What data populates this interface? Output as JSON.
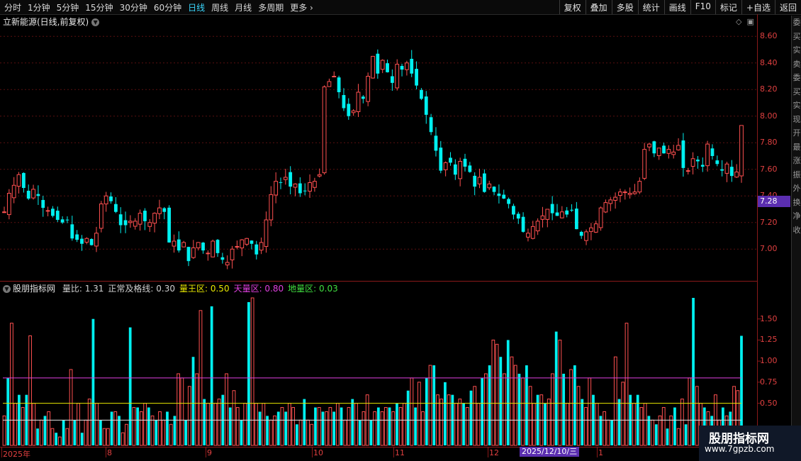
{
  "toolbar": {
    "periods": [
      "分时",
      "1分钟",
      "5分钟",
      "15分钟",
      "30分钟",
      "60分钟",
      "日线",
      "周线",
      "月线",
      "多周期",
      "更多 ›"
    ],
    "active_index": 6,
    "right_buttons": [
      "复权",
      "叠加",
      "多股",
      "统计",
      "画线",
      "F10",
      "标记",
      "+自选",
      "返回"
    ]
  },
  "stock": {
    "title": "立新能源(日线,前复权)"
  },
  "side_strip": [
    "委",
    "买",
    "实",
    "卖",
    "委",
    "买",
    "实",
    "现",
    "开",
    "最",
    "涨",
    "振",
    "外",
    "换",
    "净",
    "收"
  ],
  "price_axis": [
    "8.60",
    "8.40",
    "8.20",
    "8.00",
    "7.80",
    "7.60",
    "7.40",
    "7.20",
    "7.00"
  ],
  "current_price": "7.28",
  "indicator": {
    "name": "股朋指标网",
    "items": [
      {
        "label": "量比:",
        "value": "1.31",
        "color": "#d0d0d0"
      },
      {
        "label": "正常及格线:",
        "value": "0.30",
        "color": "#d0d0d0"
      },
      {
        "label": "量王区:",
        "value": "0.50",
        "color": "#e8e800"
      },
      {
        "label": "天量区:",
        "value": "0.80",
        "color": "#e040e0"
      },
      {
        "label": "地量区:",
        "value": "0.03",
        "color": "#40e040"
      }
    ]
  },
  "volume_axis": [
    "1.50",
    "1.25",
    "1.00",
    "0.75",
    "0.50"
  ],
  "date_axis": [
    "2025年",
    "8",
    "9",
    "10",
    "11",
    "12",
    "1"
  ],
  "date_cursor": "2025/12/10/三",
  "watermark": {
    "name": "股朋指标网",
    "url": "www.7gpzb.com"
  },
  "colors": {
    "up": "#ff5050",
    "down": "#00f0f0",
    "yellow": "#e8e800",
    "magenta": "#e040e0",
    "white": "#e0e0e0"
  },
  "chart_data": [
    {
      "type": "candlestick",
      "title": "立新能源(日线,前复权)",
      "ylim": [
        6.82,
        8.66
      ],
      "close": [
        7.28,
        7.42,
        7.48,
        7.56,
        7.46,
        7.38,
        7.45,
        7.4,
        7.31,
        7.29,
        7.25,
        7.22,
        7.2,
        7.22,
        7.08,
        7.07,
        7.04,
        7.08,
        7.03,
        7.12,
        7.34,
        7.4,
        7.36,
        7.28,
        7.18,
        7.18,
        7.21,
        7.21,
        7.27,
        7.21,
        7.2,
        7.27,
        7.31,
        7.28,
        7.05,
        7.06,
        6.99,
        7.05,
        6.91,
        7.01,
        7.05,
        6.99,
        6.97,
        7.06,
        6.97,
        6.92,
        6.9,
        7.0,
        7.02,
        7.07,
        7.08,
        7.04,
        6.96,
        7.05,
        7.22,
        7.41,
        7.51,
        7.5,
        7.54,
        7.47,
        7.49,
        7.42,
        7.44,
        7.5,
        7.51,
        7.56,
        8.22,
        8.26,
        8.3,
        8.18,
        8.06,
        8.0,
        8.04,
        8.18,
        8.13,
        8.3,
        8.45,
        8.32,
        8.42,
        8.33,
        8.25,
        8.39,
        8.35,
        8.4,
        8.32,
        8.23,
        8.13,
        8.01,
        7.88,
        7.74,
        7.59,
        7.65,
        7.65,
        7.56,
        7.66,
        7.62,
        7.58,
        7.47,
        7.54,
        7.43,
        7.49,
        7.43,
        7.4,
        7.38,
        7.34,
        7.26,
        7.23,
        7.13,
        7.12,
        7.17,
        7.21,
        7.25,
        7.3,
        7.27,
        7.25,
        7.28,
        7.26,
        7.29,
        7.15,
        7.1,
        7.13,
        7.16,
        7.19,
        7.31,
        7.35,
        7.37,
        7.39,
        7.43,
        7.43,
        7.42,
        7.43,
        7.51,
        7.75,
        7.79,
        7.72,
        7.76,
        7.72,
        7.75,
        7.73,
        7.78,
        7.61,
        7.59,
        7.68,
        7.66,
        7.62,
        7.79,
        7.7,
        7.64,
        7.59,
        7.64,
        7.55,
        7.58,
        7.93
      ]
    },
    {
      "type": "bar",
      "title": "股朋指标网",
      "ylim": [
        0,
        1.75
      ],
      "reference_lines": [
        {
          "name": "量王区",
          "value": 0.5
        },
        {
          "name": "天量区",
          "value": 0.8
        },
        {
          "name": "正常及格线",
          "value": 0.3
        }
      ],
      "values": [
        0.35,
        0.8,
        1.45,
        0.5,
        0.6,
        0.45,
        0.6,
        1.3,
        0.5,
        0.2,
        0.3,
        0.35,
        0.4,
        0.2,
        0.15,
        0.1,
        0.3,
        0.2,
        0.9,
        0.3,
        0.5,
        0.15,
        0.3,
        0.55,
        1.5,
        0.5,
        0.3,
        0.2,
        0.2,
        0.4,
        0.4,
        0.35,
        0.15,
        0.25,
        1.4,
        0.45,
        0.45,
        0.4,
        0.5,
        0.45,
        0.35,
        0.3,
        0.4,
        0.3,
        0.4,
        0.25,
        0.35,
        0.85,
        0.8,
        0.3,
        0.7,
        1.05,
        0.85,
        1.6,
        0.55,
        0.5,
        1.65,
        0.5,
        0.55,
        0.6,
        0.85,
        0.45,
        0.65,
        0.45,
        0.3,
        0.5,
        1.7,
        1.75,
        0.5,
        0.4,
        0.5,
        0.35,
        0.3,
        0.35,
        0.4,
        0.45,
        0.4,
        0.5,
        0.45,
        0.25,
        0.3,
        0.55,
        0.3,
        0.25,
        0.45,
        0.45,
        0.4,
        0.4,
        0.45,
        0.4,
        0.5,
        0.45,
        0.3,
        0.45,
        0.55,
        0.5,
        0.3,
        0.4,
        0.6,
        0.3,
        0.4,
        0.45,
        0.4,
        0.45,
        0.45,
        0.4,
        0.5,
        0.45,
        0.5,
        0.65,
        0.8,
        0.45,
        0.75,
        0.4,
        0.8,
        0.95,
        0.95,
        0.6,
        0.55,
        0.75,
        0.6,
        0.6,
        0.5,
        0.55,
        0.5,
        0.45,
        0.65,
        0.7,
        0.5,
        0.8,
        0.85,
        0.95,
        1.25,
        1.2,
        1.05,
        0.85,
        1.25,
        1.05,
        0.95,
        0.85,
        0.8,
        0.95,
        0.7,
        0.5,
        0.6,
        0.6,
        0.5,
        0.55,
        0.85,
        1.35,
        1.25,
        0.85,
        0.5,
        0.9,
        0.95,
        0.7,
        0.55,
        0.45,
        0.8,
        0.6,
        0.5,
        0.35,
        0.4,
        0.3,
        0.3,
        1.05,
        0.55,
        0.75,
        1.45,
        0.6,
        0.5,
        0.6,
        0.45,
        0.5,
        0.35,
        0.3,
        0.25,
        0.35,
        0.45,
        0.2,
        0.35,
        0.45,
        0.2,
        0.55,
        0.25,
        0.8,
        1.75,
        0.7,
        0.5,
        0.45,
        0.4,
        0.35,
        0.6,
        0.3,
        0.45,
        0.35,
        0.4,
        0.7,
        0.65,
        1.3
      ]
    }
  ]
}
